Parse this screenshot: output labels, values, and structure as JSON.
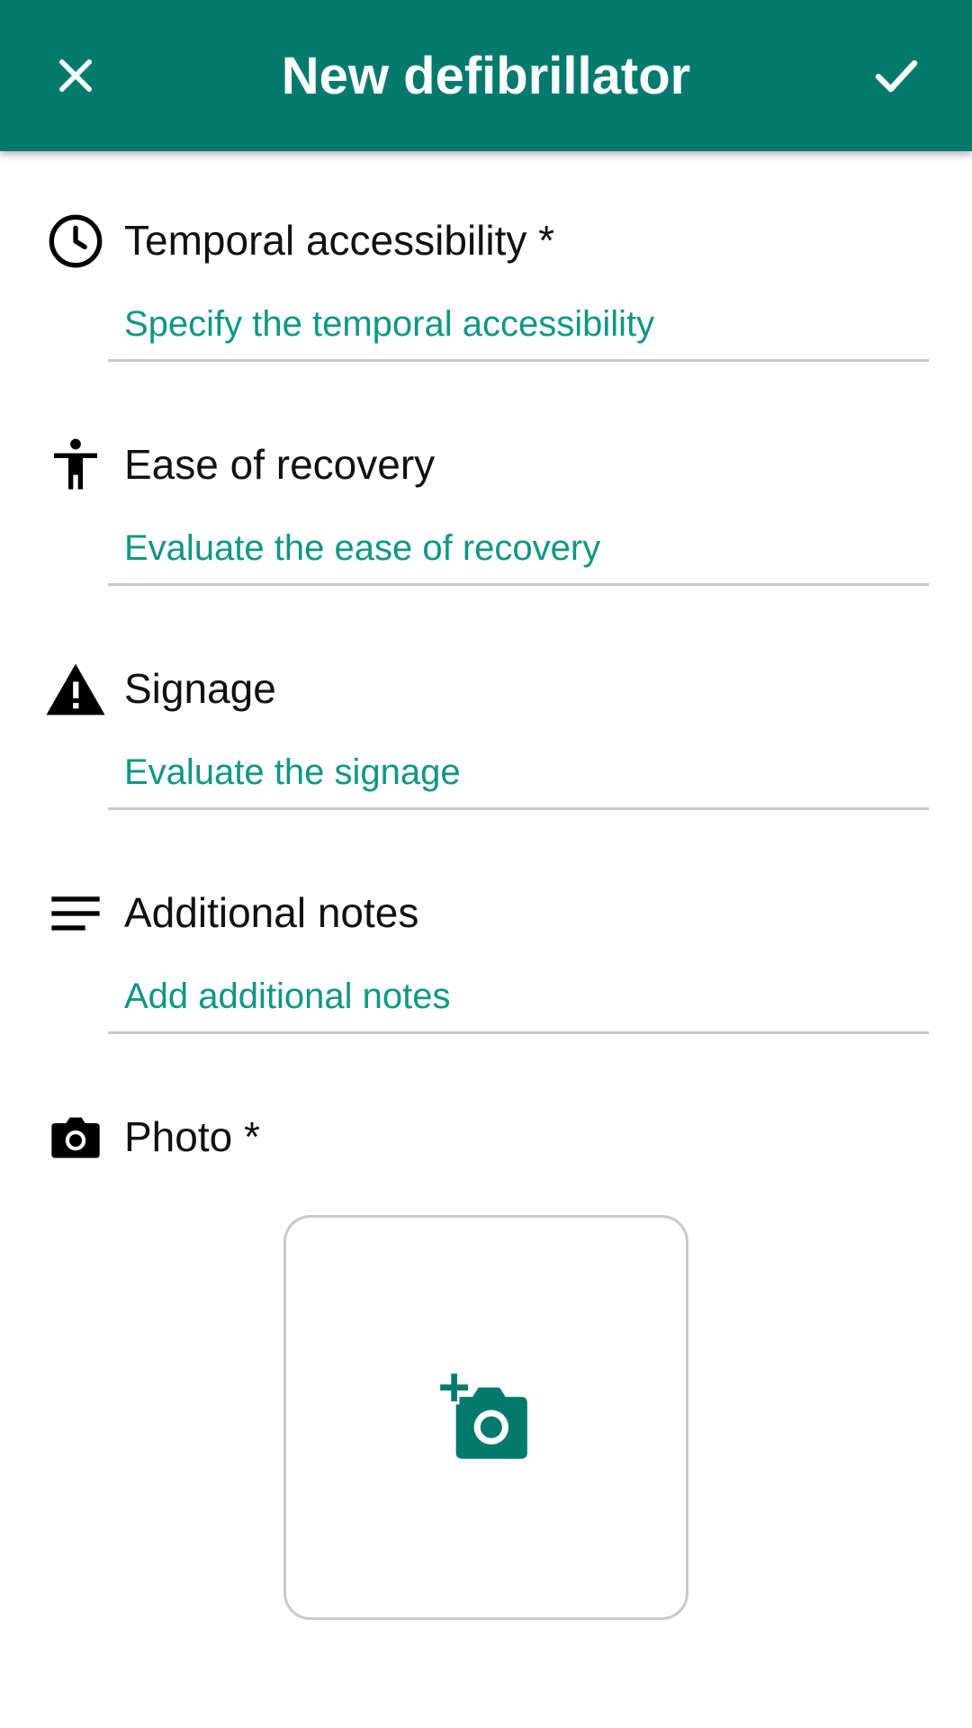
{
  "appbar": {
    "title": "New defibrillator",
    "close_icon": "close-icon",
    "confirm_icon": "check-icon",
    "background": "#047a6e"
  },
  "sections": [
    {
      "icon": "clock-icon",
      "label": "Temporal accessibility *",
      "placeholder": "Specify the temporal accessibility"
    },
    {
      "icon": "accessibility-person-icon",
      "label": "Ease of recovery",
      "placeholder": "Evaluate the ease of recovery"
    },
    {
      "icon": "warning-icon",
      "label": "Signage",
      "placeholder": "Evaluate the signage"
    },
    {
      "icon": "notes-icon",
      "label": "Additional notes",
      "placeholder": "Add additional notes"
    }
  ],
  "photo": {
    "icon": "camera-icon",
    "label": "Photo *",
    "add_icon": "add-photo-icon"
  },
  "colors": {
    "accent": "#0f9684",
    "primary_dark": "#047a6e",
    "divider": "#c9c9c9"
  }
}
